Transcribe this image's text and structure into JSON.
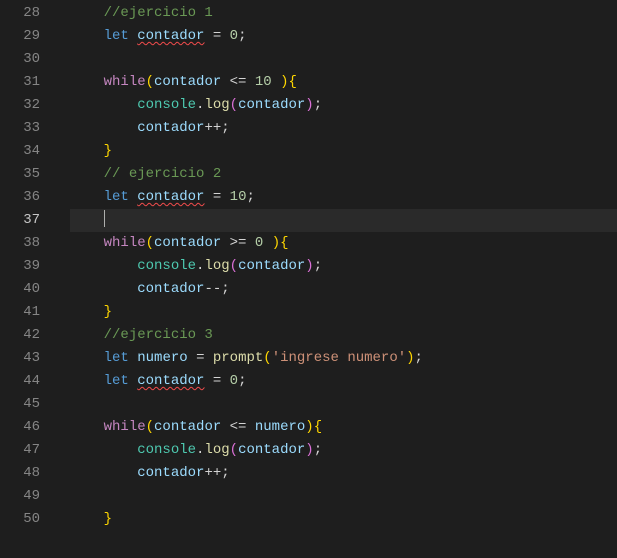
{
  "editor": {
    "active_line": 37,
    "lines": [
      {
        "num": 28,
        "tokens": [
          [
            "    ",
            "punc"
          ],
          [
            "//ejercicio 1",
            "comment"
          ]
        ]
      },
      {
        "num": 29,
        "tokens": [
          [
            "    ",
            "punc"
          ],
          [
            "let",
            "keyword"
          ],
          [
            " ",
            "punc"
          ],
          [
            "contador",
            "ident",
            true
          ],
          [
            " ",
            "punc"
          ],
          [
            "=",
            "punc"
          ],
          [
            " ",
            "punc"
          ],
          [
            "0",
            "num"
          ],
          [
            ";",
            "punc"
          ]
        ]
      },
      {
        "num": 30,
        "tokens": []
      },
      {
        "num": 31,
        "tokens": [
          [
            "    ",
            "punc"
          ],
          [
            "while",
            "control"
          ],
          [
            "(",
            "brace0"
          ],
          [
            "contador",
            "ident"
          ],
          [
            " ",
            "punc"
          ],
          [
            "<=",
            "punc"
          ],
          [
            " ",
            "punc"
          ],
          [
            "10",
            "num"
          ],
          [
            " ",
            "punc"
          ],
          [
            ")",
            "brace0"
          ],
          [
            "{",
            "brace0"
          ]
        ]
      },
      {
        "num": 32,
        "tokens": [
          [
            "        ",
            "punc"
          ],
          [
            "console",
            "obj"
          ],
          [
            ".",
            "punc"
          ],
          [
            "log",
            "func"
          ],
          [
            "(",
            "brace1"
          ],
          [
            "contador",
            "ident"
          ],
          [
            ")",
            "brace1"
          ],
          [
            ";",
            "punc"
          ]
        ]
      },
      {
        "num": 33,
        "tokens": [
          [
            "        ",
            "punc"
          ],
          [
            "contador",
            "ident"
          ],
          [
            "++",
            "punc"
          ],
          [
            ";",
            "punc"
          ]
        ]
      },
      {
        "num": 34,
        "tokens": [
          [
            "    ",
            "punc"
          ],
          [
            "}",
            "brace0"
          ]
        ]
      },
      {
        "num": 35,
        "tokens": [
          [
            "    ",
            "punc"
          ],
          [
            "// ejercicio 2",
            "comment"
          ]
        ]
      },
      {
        "num": 36,
        "tokens": [
          [
            "    ",
            "punc"
          ],
          [
            "let",
            "keyword"
          ],
          [
            " ",
            "punc"
          ],
          [
            "contador",
            "ident",
            true
          ],
          [
            " ",
            "punc"
          ],
          [
            "=",
            "punc"
          ],
          [
            " ",
            "punc"
          ],
          [
            "10",
            "num"
          ],
          [
            ";",
            "punc"
          ]
        ]
      },
      {
        "num": 37,
        "tokens": [],
        "cursor": true
      },
      {
        "num": 38,
        "tokens": [
          [
            "    ",
            "punc"
          ],
          [
            "while",
            "control"
          ],
          [
            "(",
            "brace0"
          ],
          [
            "contador",
            "ident"
          ],
          [
            " ",
            "punc"
          ],
          [
            ">=",
            "punc"
          ],
          [
            " ",
            "punc"
          ],
          [
            "0",
            "num"
          ],
          [
            " ",
            "punc"
          ],
          [
            ")",
            "brace0"
          ],
          [
            "{",
            "brace0"
          ]
        ]
      },
      {
        "num": 39,
        "tokens": [
          [
            "        ",
            "punc"
          ],
          [
            "console",
            "obj"
          ],
          [
            ".",
            "punc"
          ],
          [
            "log",
            "func"
          ],
          [
            "(",
            "brace1"
          ],
          [
            "contador",
            "ident"
          ],
          [
            ")",
            "brace1"
          ],
          [
            ";",
            "punc"
          ]
        ]
      },
      {
        "num": 40,
        "tokens": [
          [
            "        ",
            "punc"
          ],
          [
            "contador",
            "ident"
          ],
          [
            "--",
            "punc"
          ],
          [
            ";",
            "punc"
          ]
        ]
      },
      {
        "num": 41,
        "tokens": [
          [
            "    ",
            "punc"
          ],
          [
            "}",
            "brace0"
          ]
        ]
      },
      {
        "num": 42,
        "tokens": [
          [
            "    ",
            "punc"
          ],
          [
            "//ejercicio 3",
            "comment"
          ]
        ]
      },
      {
        "num": 43,
        "tokens": [
          [
            "    ",
            "punc"
          ],
          [
            "let",
            "keyword"
          ],
          [
            " ",
            "punc"
          ],
          [
            "numero",
            "ident"
          ],
          [
            " ",
            "punc"
          ],
          [
            "=",
            "punc"
          ],
          [
            " ",
            "punc"
          ],
          [
            "prompt",
            "func"
          ],
          [
            "(",
            "brace0"
          ],
          [
            "'ingrese numero'",
            "str"
          ],
          [
            ")",
            "brace0"
          ],
          [
            ";",
            "punc"
          ]
        ]
      },
      {
        "num": 44,
        "tokens": [
          [
            "    ",
            "punc"
          ],
          [
            "let",
            "keyword"
          ],
          [
            " ",
            "punc"
          ],
          [
            "contador",
            "ident",
            true
          ],
          [
            " ",
            "punc"
          ],
          [
            "=",
            "punc"
          ],
          [
            " ",
            "punc"
          ],
          [
            "0",
            "num"
          ],
          [
            ";",
            "punc"
          ]
        ]
      },
      {
        "num": 45,
        "tokens": []
      },
      {
        "num": 46,
        "tokens": [
          [
            "    ",
            "punc"
          ],
          [
            "while",
            "control"
          ],
          [
            "(",
            "brace0"
          ],
          [
            "contador",
            "ident"
          ],
          [
            " ",
            "punc"
          ],
          [
            "<=",
            "punc"
          ],
          [
            " ",
            "punc"
          ],
          [
            "numero",
            "ident"
          ],
          [
            ")",
            "brace0"
          ],
          [
            "{",
            "brace0"
          ]
        ]
      },
      {
        "num": 47,
        "tokens": [
          [
            "        ",
            "punc"
          ],
          [
            "console",
            "obj"
          ],
          [
            ".",
            "punc"
          ],
          [
            "log",
            "func"
          ],
          [
            "(",
            "brace1"
          ],
          [
            "contador",
            "ident"
          ],
          [
            ")",
            "brace1"
          ],
          [
            ";",
            "punc"
          ]
        ]
      },
      {
        "num": 48,
        "tokens": [
          [
            "        ",
            "punc"
          ],
          [
            "contador",
            "ident"
          ],
          [
            "++",
            "punc"
          ],
          [
            ";",
            "punc"
          ]
        ]
      },
      {
        "num": 49,
        "tokens": []
      },
      {
        "num": 50,
        "tokens": [
          [
            "    ",
            "punc"
          ],
          [
            "}",
            "brace0"
          ]
        ]
      }
    ]
  }
}
